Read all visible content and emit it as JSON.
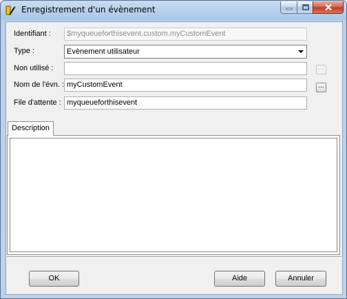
{
  "window": {
    "title": "Enregistrement d'un évènement",
    "icon": "pen-tool-icon"
  },
  "titlebar_buttons": {
    "minimize": "minimize-icon",
    "maximize": "maximize-icon",
    "close": "close-icon"
  },
  "form": {
    "identifiant": {
      "label": "Identifiant :",
      "value": "$myqueueforthisevent.custom.myCustomEvent"
    },
    "type": {
      "label": "Type :",
      "value": "Evènement utilisateur"
    },
    "non_utilise": {
      "label": "Non utilisé :",
      "value": "",
      "browse": "..."
    },
    "nom_evn": {
      "label": "Nom de l'évn. :",
      "value": "myCustomEvent",
      "browse": "..."
    },
    "file_attente": {
      "label": "File d'attente :",
      "value": "myqueueforthisevent"
    }
  },
  "tabs": [
    {
      "label": "Description"
    }
  ],
  "description": "",
  "buttons": {
    "ok": "OK",
    "aide": "Aide",
    "annuler": "Annuler"
  }
}
